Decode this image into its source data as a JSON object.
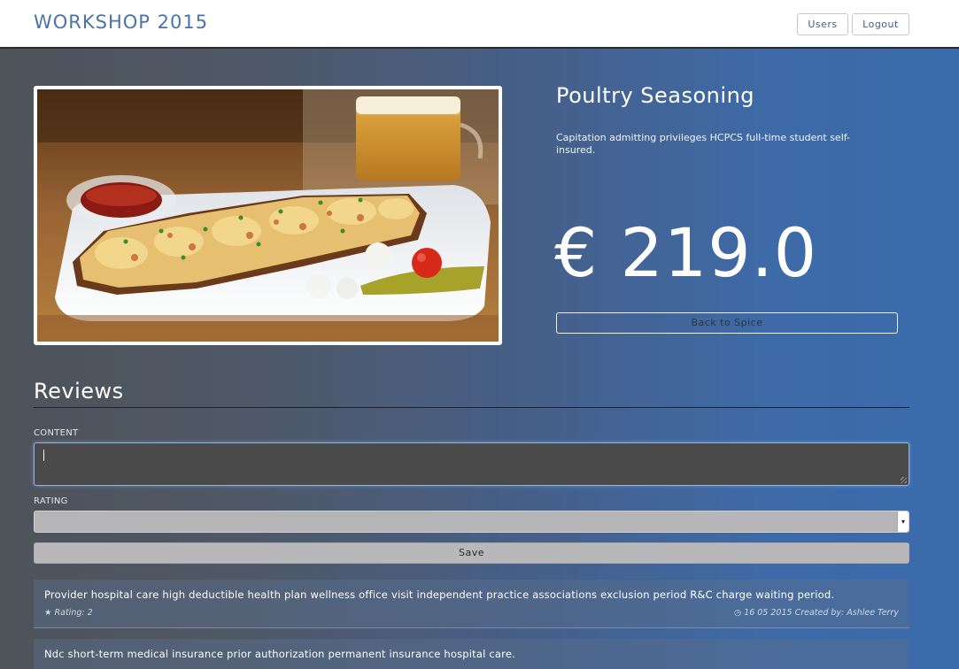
{
  "navbar": {
    "brand": "WORKSHOP 2015",
    "users_label": "Users",
    "logout_label": "Logout"
  },
  "product": {
    "title": "Poultry Seasoning",
    "description": "Capitation admitting privileges HCPCS full-time student self-insured.",
    "price": "€ 219.0",
    "back_label": "Back to Spice"
  },
  "reviews": {
    "heading": "Reviews",
    "form": {
      "content_label": "CONTENT",
      "content_value": "",
      "rating_label": "RATING",
      "rating_value": "",
      "save_label": "Save"
    },
    "items": [
      {
        "text": "Provider hospital care high deductible health plan wellness office visit independent practice associations exclusion period R&C charge waiting period.",
        "rating": "Rating: 2",
        "meta": "16 05 2015 Created by: Ashlee Terry"
      },
      {
        "text": "Ndc short-term medical insurance prior authorization permanent insurance hospital care.",
        "rating": "",
        "meta": ""
      }
    ]
  },
  "icons": {
    "star": "★",
    "clock": "◷"
  }
}
